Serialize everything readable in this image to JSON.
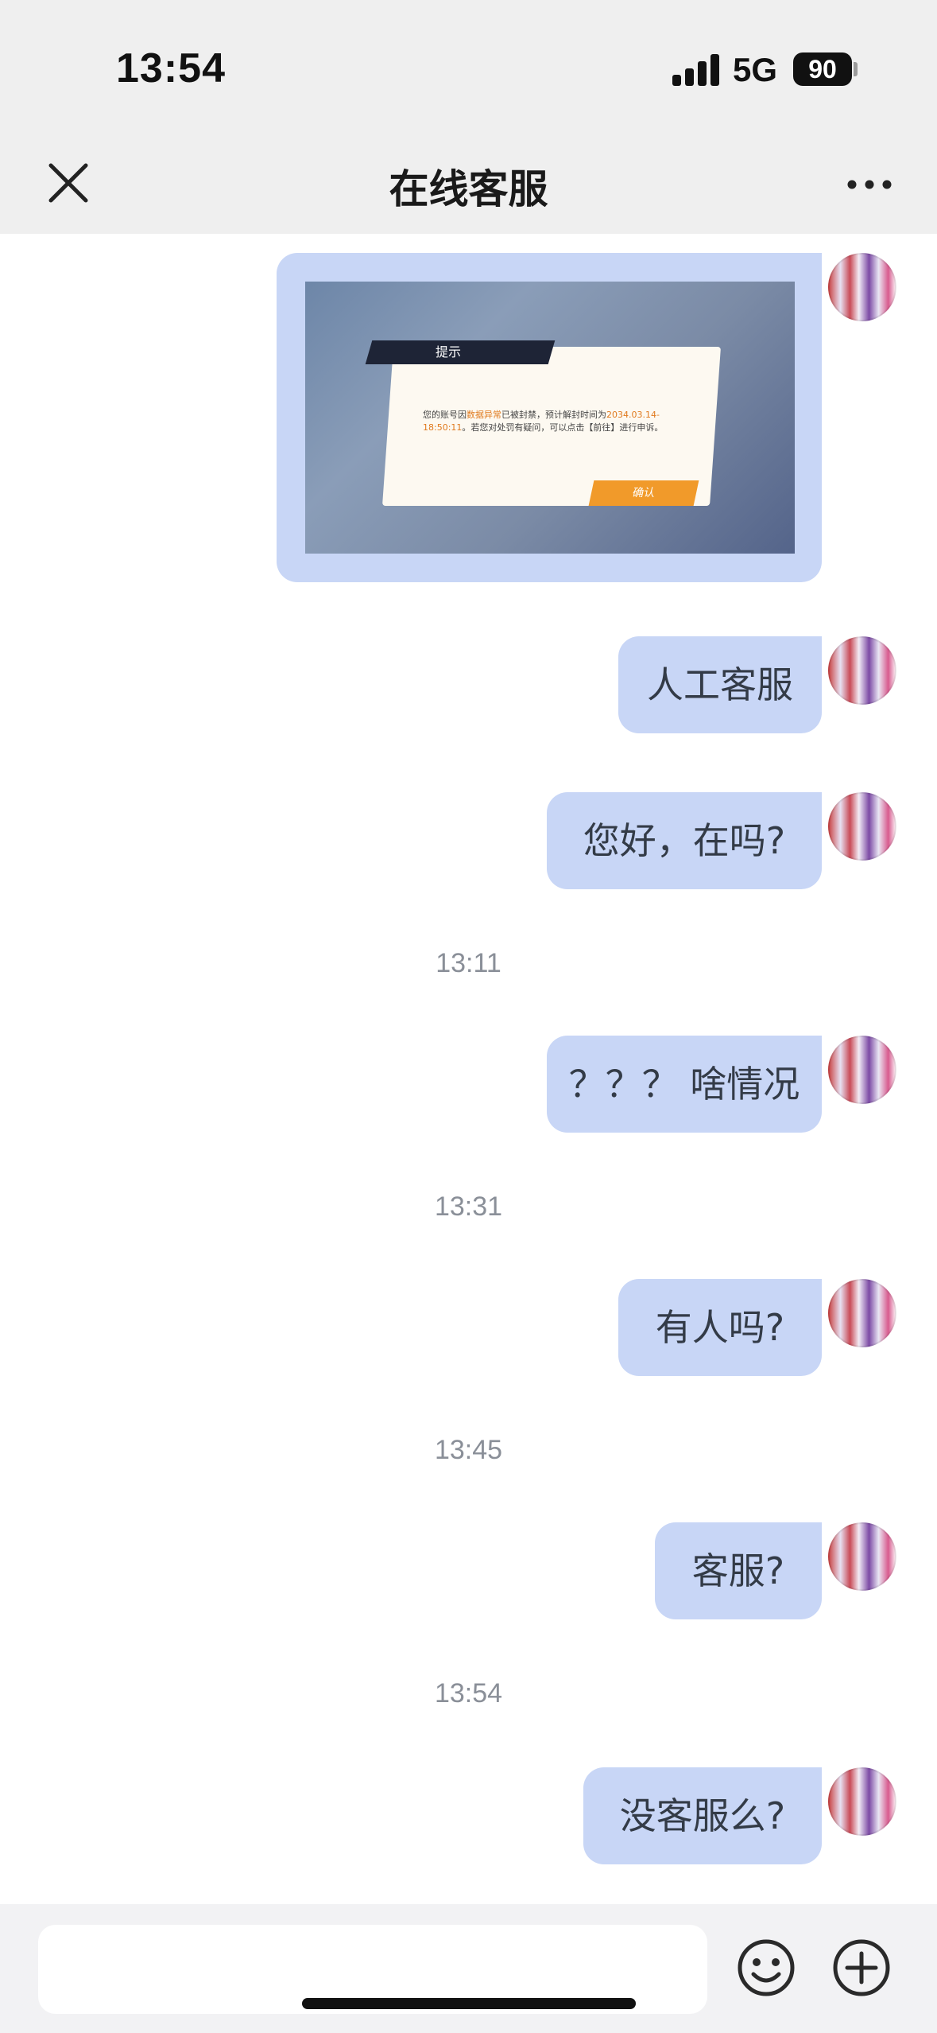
{
  "status_bar": {
    "time": "13:54",
    "network": "5G",
    "battery": "90"
  },
  "nav": {
    "title": "在线客服"
  },
  "screenshot_dialog": {
    "title": "提示",
    "text_before": "您的账号因",
    "highlight": "数据异常",
    "text_mid": "已被封禁，预计解封时间为",
    "ban_until": "2034.03.14-18:50:11",
    "text_after": "。若您对处罚有疑问，可以点击【前往】进行申诉。",
    "confirm": "确认"
  },
  "messages": [
    {
      "type": "text",
      "text": "人工客服"
    },
    {
      "type": "text",
      "text": "您好，在吗?"
    },
    {
      "type": "time",
      "text": "13:11"
    },
    {
      "type": "text",
      "text": "？？？ 啥情况"
    },
    {
      "type": "time",
      "text": "13:31"
    },
    {
      "type": "text",
      "text": "有人吗?"
    },
    {
      "type": "time",
      "text": "13:45"
    },
    {
      "type": "text",
      "text": "客服?"
    },
    {
      "type": "time",
      "text": "13:54"
    },
    {
      "type": "text",
      "text": "没客服么?"
    }
  ],
  "icons": {
    "close": "close-icon",
    "more": "more-icon",
    "emoji": "emoji-icon",
    "plus": "plus-icon"
  },
  "colors": {
    "bubble": "#c8d6f6",
    "header": "#efefef",
    "timestamp": "#8a8f98"
  }
}
